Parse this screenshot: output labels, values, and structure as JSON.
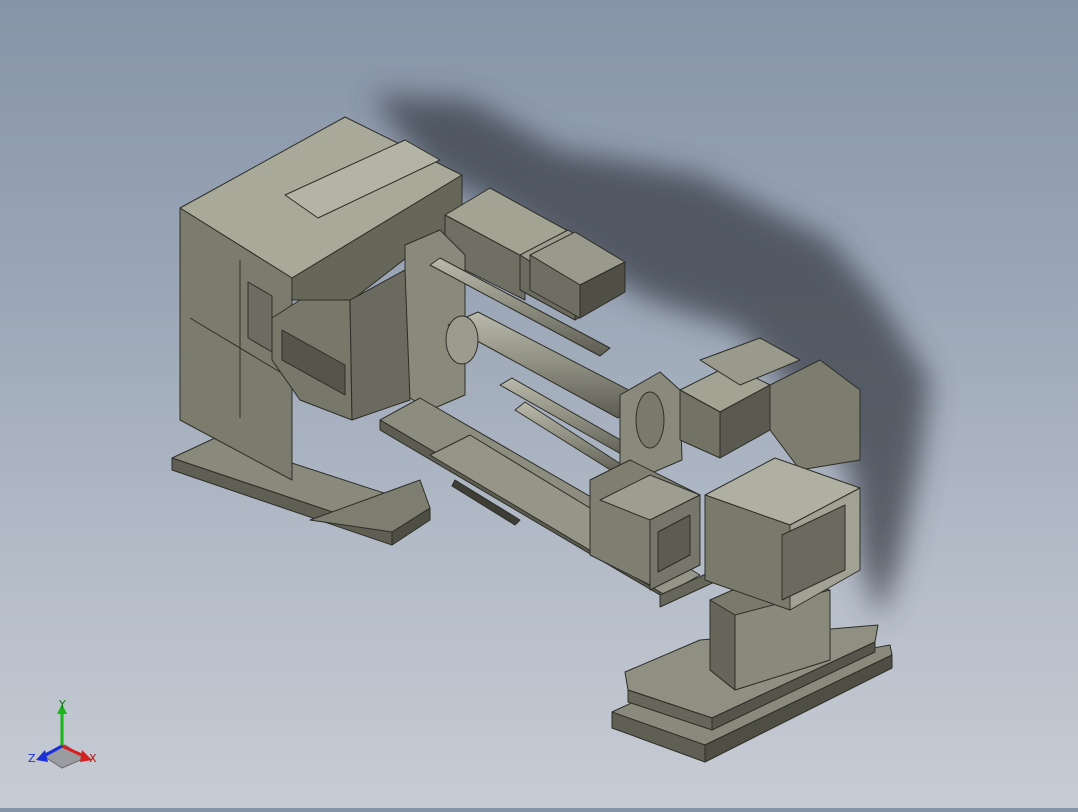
{
  "scene": {
    "background_top": "#8794a7",
    "background_bottom": "#c7ccd4",
    "body_color": "#7a7a6c",
    "body_light": "#a3a394",
    "body_dark": "#55554b",
    "edge_color": "#2e2e28",
    "shadow_color": "#3a3f48"
  },
  "triad": {
    "x_label": "X",
    "y_label": "Y",
    "z_label": "Z",
    "x_color": "#d62020",
    "y_color": "#19b519",
    "z_color": "#1a2fd8"
  }
}
